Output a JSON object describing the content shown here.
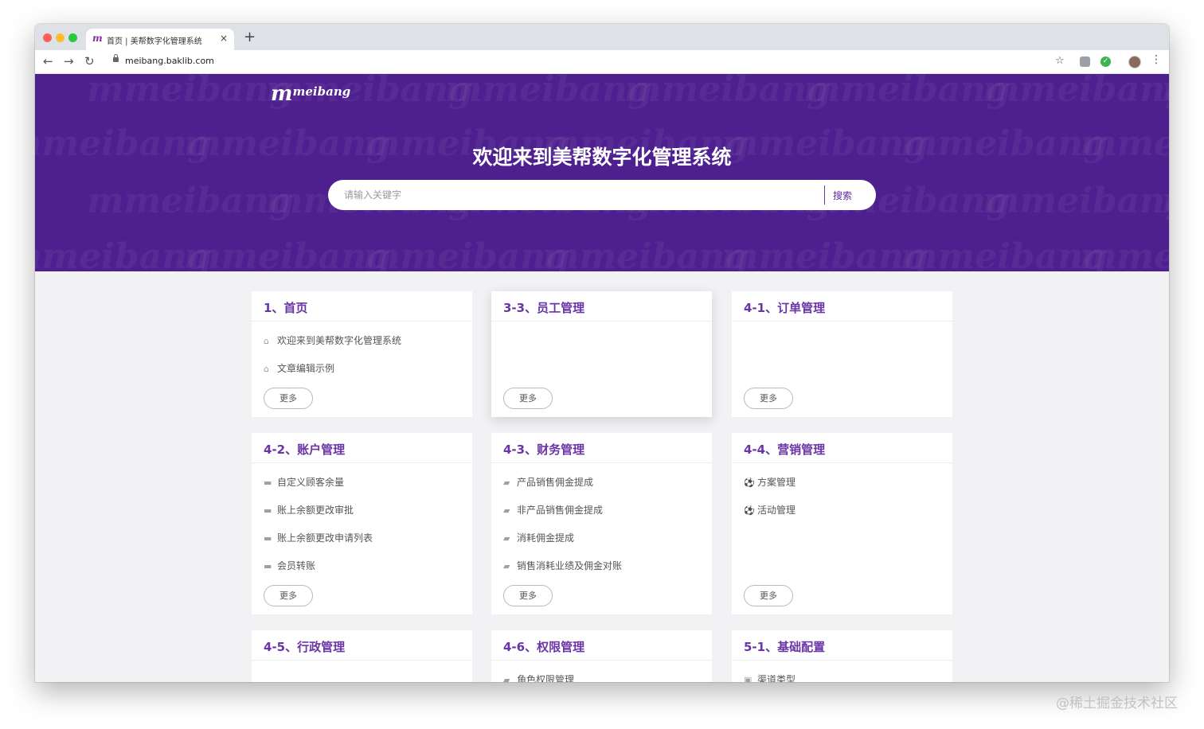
{
  "browser": {
    "tab_title": "首页 | 美帮数字化管理系统",
    "tab_favicon": "m",
    "tab_close": "×",
    "new_tab": "+",
    "url": "meibang.baklib.com",
    "back_icon": "←",
    "forward_icon": "→",
    "reload_icon": "↻",
    "star_icon": "☆",
    "ext_check": "✓",
    "menu_icon": "⋮"
  },
  "hero": {
    "logo_m": "m",
    "logo_text": "meibang",
    "watermark": "mmeibang",
    "title": "欢迎来到美帮数字化管理系统",
    "search_placeholder": "请输入关键字",
    "search_button": "搜索",
    "bg_color": "#4e1f8e"
  },
  "cards": [
    {
      "title": "1、首页",
      "icon": "home-icon",
      "items": [
        "欢迎来到美帮数字化管理系统",
        "文章编辑示例"
      ],
      "more": "更多"
    },
    {
      "title": "3-3、员工管理",
      "icon": "",
      "items": [],
      "more": "更多"
    },
    {
      "title": "4-1、订单管理",
      "icon": "",
      "items": [],
      "more": "更多"
    },
    {
      "title": "4-2、账户管理",
      "icon": "folder-icon",
      "items": [
        "自定义顾客余量",
        "账上余额更改审批",
        "账上余额更改申请列表",
        "会员转账"
      ],
      "more": "更多"
    },
    {
      "title": "4-3、财务管理",
      "icon": "book-icon",
      "items": [
        "产品销售佣金提成",
        "非产品销售佣金提成",
        "消耗佣金提成",
        "销售消耗业绩及佣金对账"
      ],
      "more": "更多"
    },
    {
      "title": "4-4、营销管理",
      "icon": "soccer-icon",
      "items": [
        "方案管理",
        "活动管理"
      ],
      "more": "更多"
    },
    {
      "title": "4-5、行政管理",
      "icon": "",
      "items": [],
      "more": ""
    },
    {
      "title": "4-6、权限管理",
      "icon": "book-icon",
      "items": [
        "角色权限管理"
      ],
      "more": ""
    },
    {
      "title": "5-1、基础配置",
      "icon": "picture-icon",
      "items": [
        "渠道类型"
      ],
      "more": ""
    }
  ],
  "icon_glyphs": {
    "home-icon": "⌂",
    "folder-icon": "▬",
    "book-icon": "▰",
    "soccer-icon": "⚽",
    "picture-icon": "▣"
  },
  "watermark_credit": "@稀土掘金技术社区",
  "colors": {
    "accent": "#6a35a6",
    "hero": "#4e1f8e"
  }
}
